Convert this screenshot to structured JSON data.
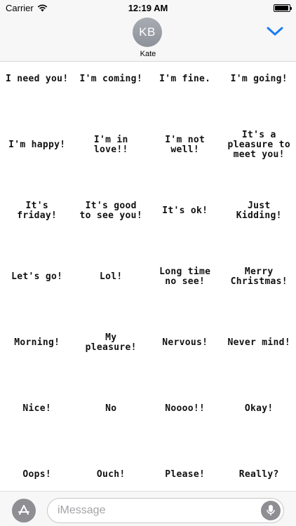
{
  "status_bar": {
    "carrier": "Carrier",
    "time": "12:19 AM",
    "battery_level": 0.95
  },
  "header": {
    "avatar_initials": "KB",
    "contact_name": "Kate"
  },
  "stickers": [
    "I need you!",
    "I'm coming!",
    "I'm fine.",
    "I'm going!",
    "I'm happy!",
    "I'm in\nlove!!",
    "I'm not\nwell!",
    "It's a\npleasure to\nmeet you!",
    "It's friday!",
    "It's good\nto see you!",
    "It's ok!",
    "Just\nKidding!",
    "Let's go!",
    "Lol!",
    "Long time\nno see!",
    "Merry\nChristmas!",
    "Morning!",
    "My\npleasure!",
    "Nervous!",
    "Never mind!",
    "Nice!",
    "No",
    "Noooo!!",
    "Okay!",
    "Oops!",
    "Ouch!",
    "Please!",
    "Really?"
  ],
  "input_bar": {
    "placeholder": "iMessage"
  },
  "icons": {
    "wifi": "wifi-icon",
    "battery": "battery-icon",
    "collapse": "chevron-down-icon",
    "app_store": "app-store-icon",
    "mic": "microphone-icon"
  },
  "colors": {
    "accent": "#1a7cf2",
    "header_bg": "#f7f7f7",
    "avatar_bg": "#9a9ea6",
    "icon_gray": "#8e8e93"
  }
}
